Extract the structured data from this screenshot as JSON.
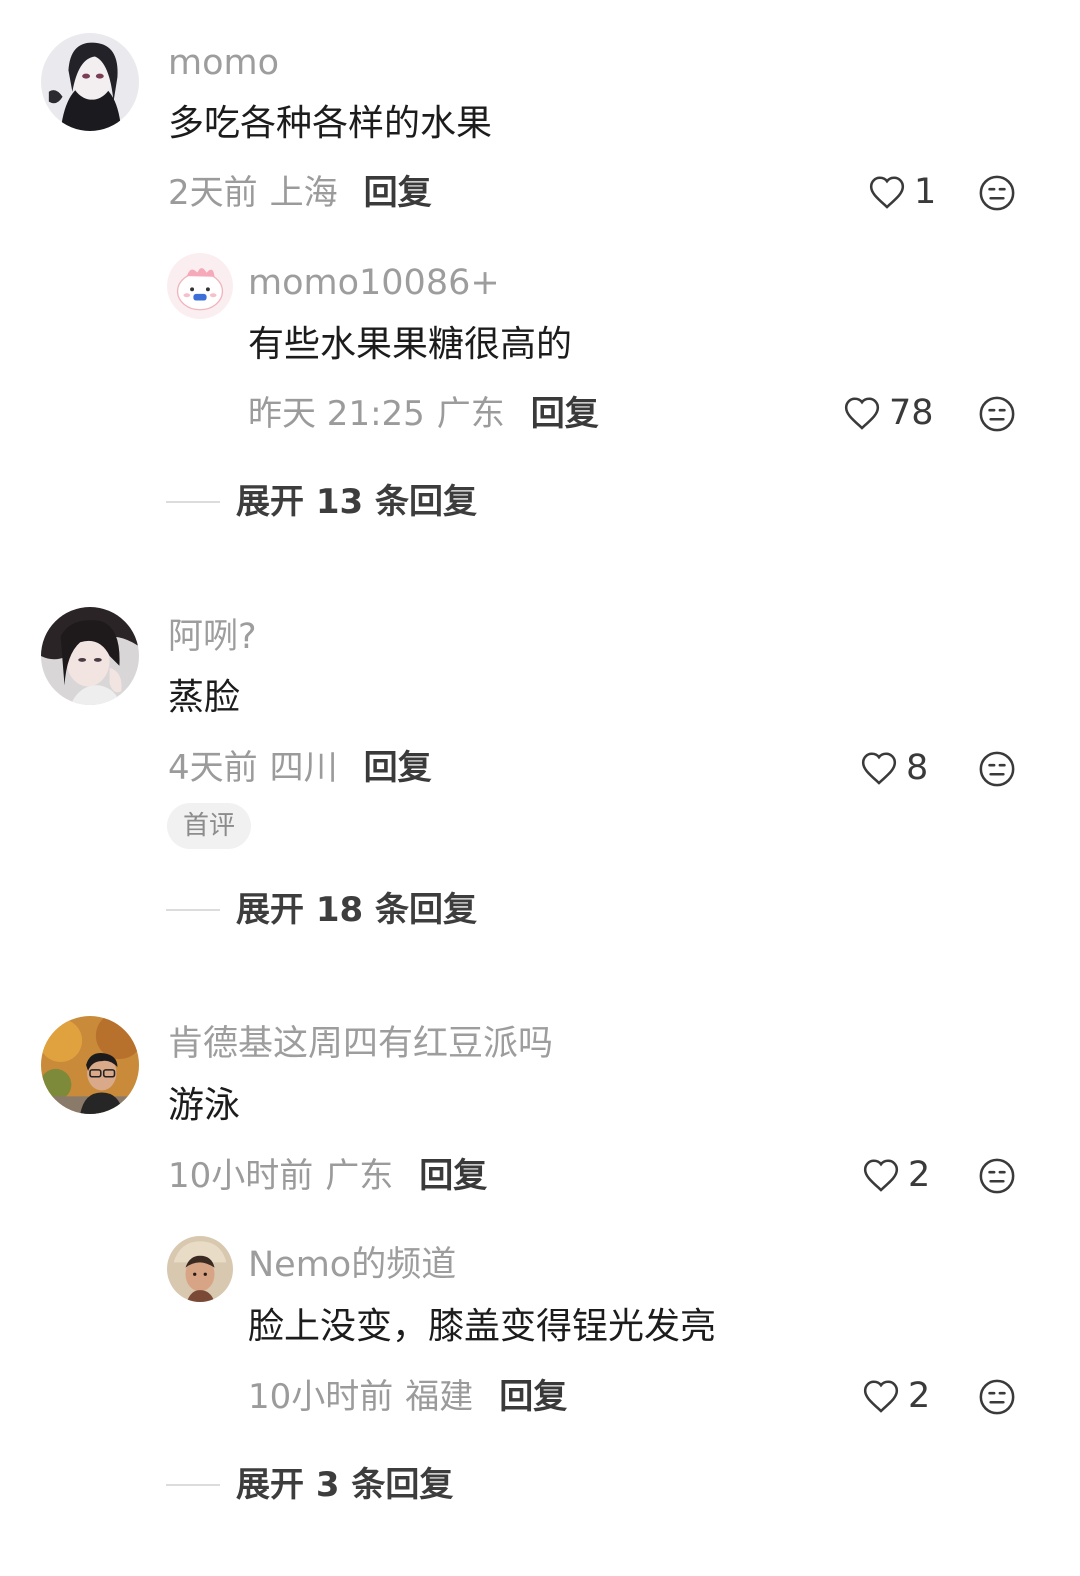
{
  "icons": {
    "like": "heart-outline-icon",
    "dislike": "meh-face-icon"
  },
  "colors": {
    "meta": "#9b9b9b",
    "name": "#9d9d9d",
    "text": "#1c1c1c",
    "badge_bg": "#f1f1f1"
  },
  "comments": [
    {
      "user": "momo",
      "text": "多吃各种各样的水果",
      "time": "2天前",
      "location": "上海",
      "reply_label": "回复",
      "likes": "1",
      "replies": [
        {
          "user": "momo10086+",
          "text": "有些水果果糖很高的",
          "time": "昨天 21:25",
          "location": "广东",
          "reply_label": "回复",
          "likes": "78"
        }
      ],
      "expand_label": "展开 13 条回复"
    },
    {
      "user": "阿咧?",
      "text": "蒸脸",
      "time": "4天前",
      "location": "四川",
      "reply_label": "回复",
      "likes": "8",
      "badge": "首评",
      "expand_label": "展开 18 条回复"
    },
    {
      "user": "肯德基这周四有红豆派吗",
      "text": "游泳",
      "time": "10小时前",
      "location": "广东",
      "reply_label": "回复",
      "likes": "2",
      "replies": [
        {
          "user": "Nemo的频道",
          "text": "脸上没变，膝盖变得锃光发亮",
          "time": "10小时前",
          "location": "福建",
          "reply_label": "回复",
          "likes": "2"
        }
      ],
      "expand_label": "展开 3 条回复"
    }
  ]
}
